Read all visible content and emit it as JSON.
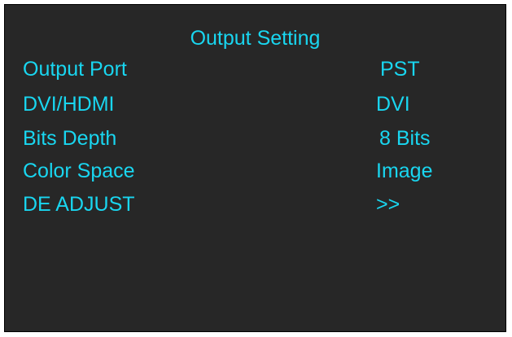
{
  "menu": {
    "title": "Output Setting",
    "items": [
      {
        "label": "Output Port",
        "value": "PST"
      },
      {
        "label": "DVI/HDMI",
        "value": "DVI"
      },
      {
        "label": "Bits Depth",
        "value": "8 Bits"
      },
      {
        "label": "Color Space",
        "value": "Image"
      },
      {
        "label": "DE ADJUST",
        "value": ">>"
      }
    ]
  },
  "colors": {
    "background": "#272727",
    "text": "#19d6f0",
    "border": "#000000"
  }
}
